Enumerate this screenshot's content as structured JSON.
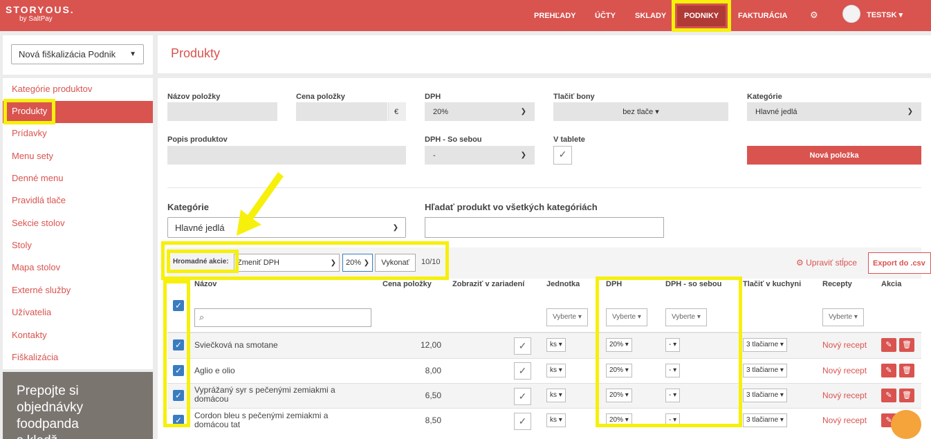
{
  "brand": {
    "name": "STORYOUS.",
    "sub": "by SaltPay"
  },
  "nav": {
    "items": [
      "PREHĽADY",
      "ÚČTY",
      "SKLADY",
      "PODNIKY",
      "FAKTURÁCIA"
    ],
    "user": "TESTSK"
  },
  "sidebar": {
    "venue_select": "Nová fiškalizácia Podnik",
    "items": [
      "Kategórie produktov",
      "Produkty",
      "Prídavky",
      "Menu sety",
      "Denné menu",
      "Pravidlá tlače",
      "Sekcie stolov",
      "Stoly",
      "Mapa stolov",
      "Externé služby",
      "Užívatelia",
      "Kontakty",
      "Fiškalizácia"
    ],
    "promo": [
      "Prepojte si",
      "objednávky",
      "foodpanda",
      "s kledž"
    ]
  },
  "page": {
    "title": "Produkty"
  },
  "form": {
    "name_label": "Názov položky",
    "price_label": "Cena položky",
    "currency": "€",
    "vat_label": "DPH",
    "vat_value": "20%",
    "print_label": "Tlačiť bony",
    "print_value": "bez tlače",
    "category_label": "Kategórie",
    "category_value": "Hlavné jedlá",
    "desc_label": "Popis produktov",
    "vat_takeaway_label": "DPH - So sebou",
    "vat_takeaway_value": "-",
    "tablet_label": "V tablete",
    "new_item": "Nová položka"
  },
  "filter": {
    "category_label": "Kategórie",
    "category_value": "Hlavné jedlá",
    "search_label": "Hľadať produkt vo všetkých kategóriách"
  },
  "bulk": {
    "label": "Hromadné akcie:",
    "action": "Zmeniť DPH",
    "vat": "20%",
    "execute": "Vykonať",
    "count": "10/10",
    "edit_columns": "Upraviť stĺpce",
    "export": "Export do .csv"
  },
  "table": {
    "headers": [
      "Názov",
      "Cena položky",
      "Zobraziť v zariadení",
      "Jednotka",
      "DPH",
      "DPH - so sebou",
      "Tlačiť v kuchyni",
      "Recepty",
      "Akcia"
    ],
    "filter_placeholder": "Vyberte",
    "rows": [
      {
        "name": "Sviečková na smotane",
        "price": "12,00",
        "unit": "ks",
        "vat": "20%",
        "vat_to_go": "-",
        "print": "3 tlačiarne",
        "recipe": "Nový recept"
      },
      {
        "name": "Aglio e olio",
        "price": "8,00",
        "unit": "ks",
        "vat": "20%",
        "vat_to_go": "-",
        "print": "3 tlačiarne",
        "recipe": "Nový recept"
      },
      {
        "name": "Vyprážaný syr s pečenými zemiakmi a domácou",
        "price": "6,50",
        "unit": "ks",
        "vat": "20%",
        "vat_to_go": "-",
        "print": "3 tlačiarne",
        "recipe": "Nový recept"
      },
      {
        "name": "Cordon bleu s pečenými zemiakmi a domácou tat",
        "price": "8,50",
        "unit": "ks",
        "vat": "20%",
        "vat_to_go": "-",
        "print": "3 tlačiarne",
        "recipe": "Nový recept"
      }
    ]
  }
}
